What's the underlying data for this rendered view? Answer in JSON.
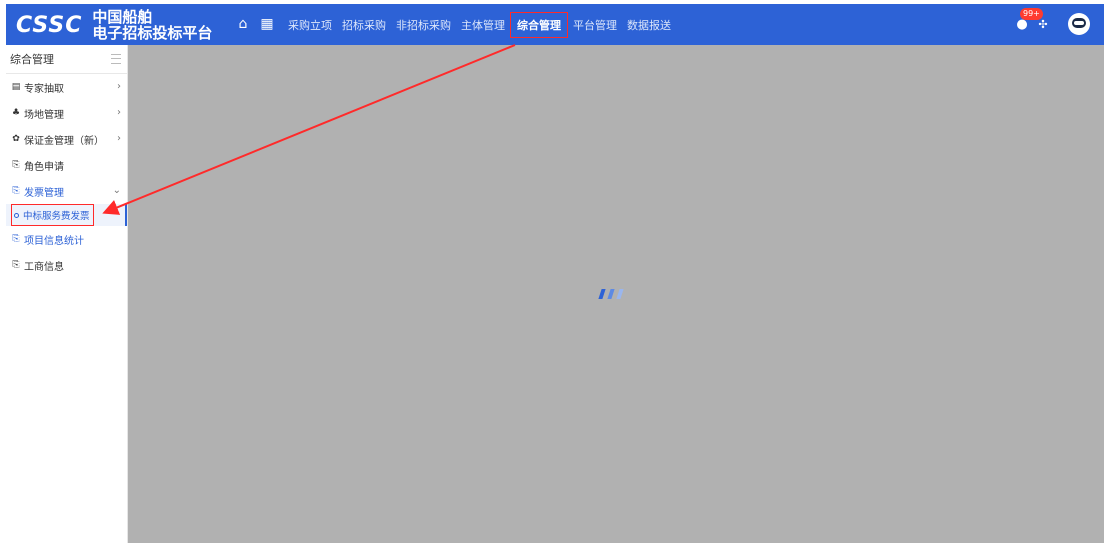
{
  "header": {
    "logo_mark": "CSSC",
    "logo_line1": "中国船舶",
    "logo_line2": "电子招标投标平台",
    "nav_items": [
      "采购立项",
      "招标采购",
      "非招标采购",
      "主体管理",
      "综合管理",
      "平台管理",
      "数据报送"
    ],
    "active_nav": "综合管理",
    "notification_count": "99+",
    "icons": [
      "home-icon",
      "apps-grid-icon",
      "bell-icon",
      "settings-icon",
      "user-avatar-icon"
    ]
  },
  "sidebar": {
    "title": "综合管理",
    "items": [
      {
        "label": "专家抽取",
        "icon": "id-card-icon",
        "chevron": "›"
      },
      {
        "label": "场地管理",
        "icon": "venue-icon",
        "chevron": "›"
      },
      {
        "label": "保证金管理（新）",
        "icon": "gears-icon",
        "chevron": "›"
      },
      {
        "label": "角色申请",
        "icon": "doc-icon"
      },
      {
        "label": "发票管理",
        "icon": "doc-icon",
        "chevron": "⌄"
      },
      {
        "label": "项目信息统计",
        "icon": "doc-icon"
      },
      {
        "label": "工商信息",
        "icon": "doc-icon"
      }
    ],
    "subitem": {
      "label": "中标服务费发票"
    }
  },
  "colors": {
    "header_bg": "#2d62d6",
    "overlay": "#b1b1b1",
    "highlight_red": "#ff2a2a",
    "spinner": [
      "#2d62d6",
      "#5d8ae4",
      "#9ab6ee"
    ]
  }
}
